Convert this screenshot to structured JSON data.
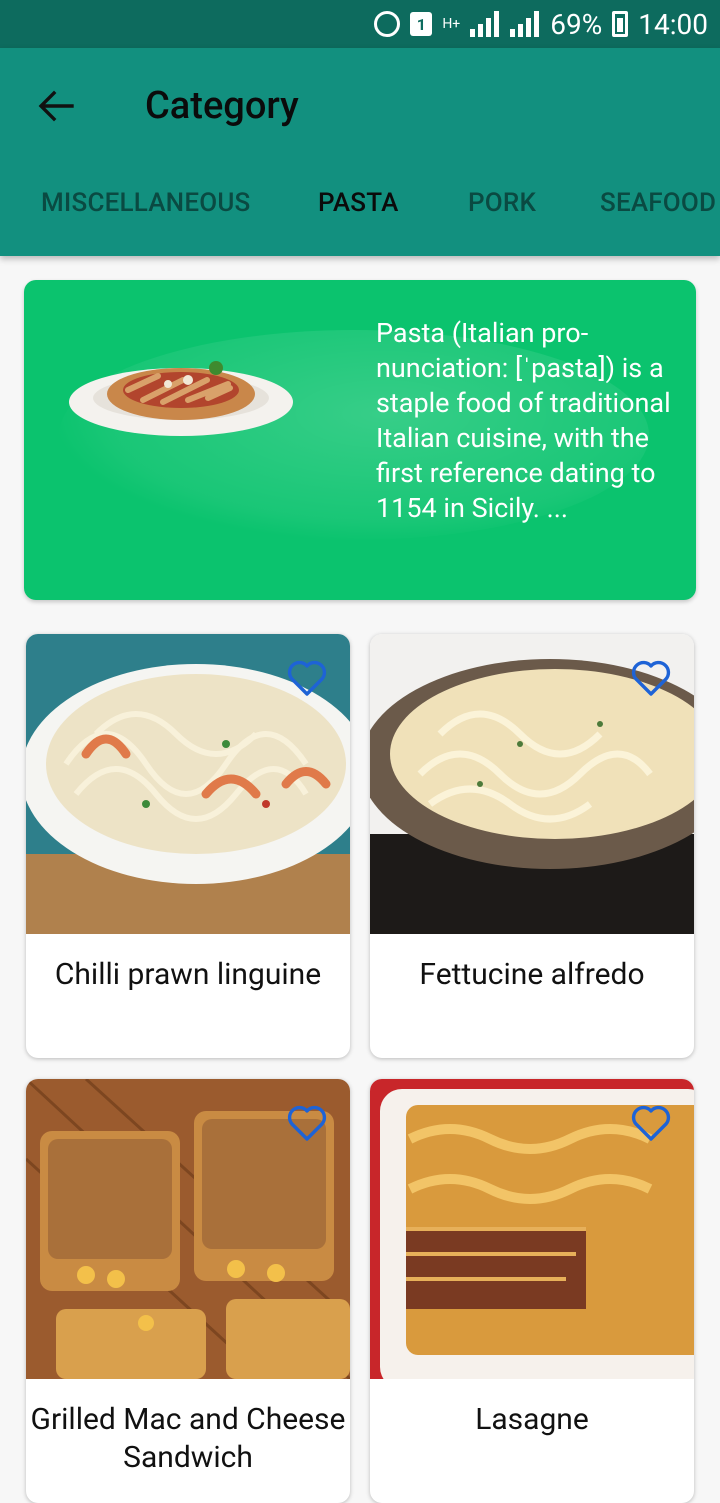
{
  "status_bar": {
    "sim_label": "1",
    "network_label": "H+",
    "battery": "69%",
    "time": "14:00"
  },
  "app_bar": {
    "title": "Category",
    "tabs": [
      "MISCELLANEOUS",
      "PASTA",
      "PORK",
      "SEAFOOD"
    ],
    "active_tab": "PASTA"
  },
  "hero": {
    "description": "Pasta (Italian pro- nunciation: [ˈpasta]) is a staple food of traditional Italian cuisine, with the first reference dating to 1154 in Sicily. ..."
  },
  "meals": [
    {
      "name": "Chilli prawn linguine"
    },
    {
      "name": "Fettucine alfredo"
    },
    {
      "name": "Grilled Mac and Cheese Sandwich"
    },
    {
      "name": "Lasagne"
    }
  ],
  "colors": {
    "status_bar": "#0d6b5e",
    "app_bar": "#12907f",
    "hero": "#0bc36e",
    "heart": "#1e63d6"
  }
}
